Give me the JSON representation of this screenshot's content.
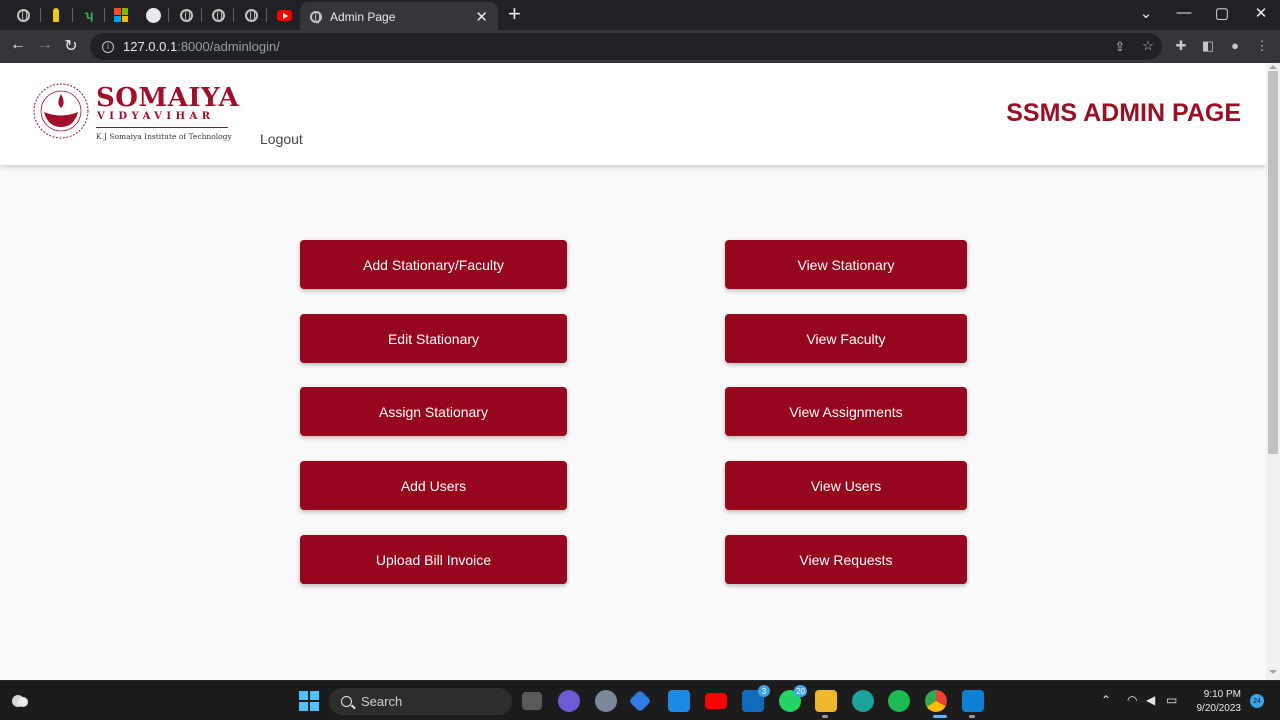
{
  "browser": {
    "active_tab_title": "Admin Page",
    "url_host": "127.0.0.1",
    "url_rest": ":8000/adminlogin/"
  },
  "header": {
    "logo_name": "SOMAIYA",
    "logo_sub": "VIDYAVIHAR",
    "logo_institute": "K J Somaiya Institute of Technology",
    "logout_label": "Logout",
    "page_title": "SSMS ADMIN PAGE"
  },
  "buttons": {
    "left": [
      "Add Stationary/Faculty",
      "Edit Stationary",
      "Assign Stationary",
      "Add Users",
      "Upload Bill Invoice"
    ],
    "right": [
      "View Stationary",
      "View Faculty",
      "View Assignments",
      "View Users",
      "View Requests"
    ]
  },
  "taskbar": {
    "search_label": "Search",
    "mail_badge": "3",
    "whatsapp_badge": "20",
    "time": "9:10 PM",
    "date": "9/20/2023",
    "notification_count": "24"
  },
  "colors": {
    "brand": "#96061c",
    "title": "#9b0f24"
  }
}
